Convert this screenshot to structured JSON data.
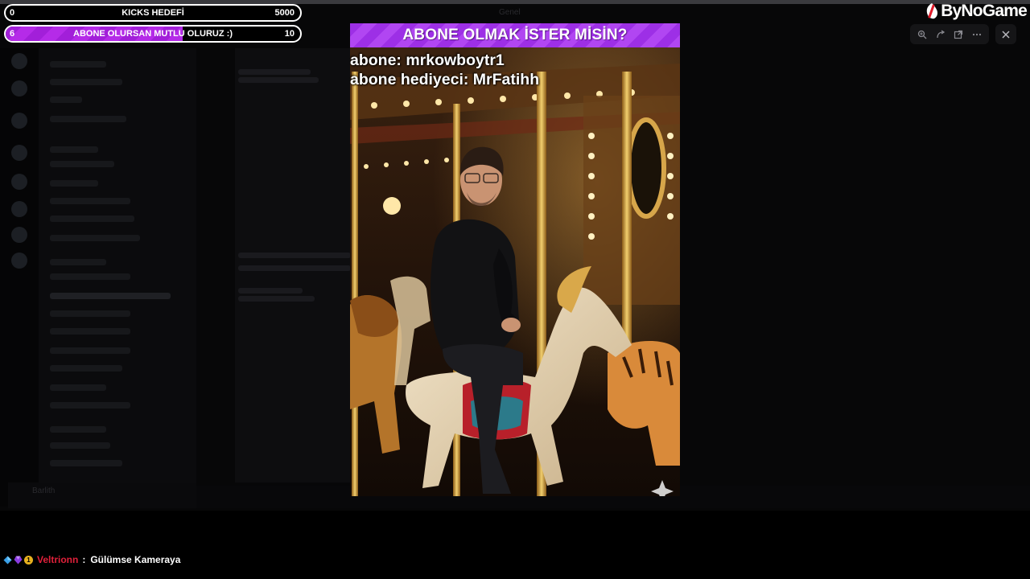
{
  "background": {
    "tab_label": "Genel",
    "user_name": "Barlith"
  },
  "goals": {
    "kicks": {
      "current": "0",
      "label": "KICKS HEDEFİ",
      "target": "5000",
      "progress": 0
    },
    "subs": {
      "current": "6",
      "label": "ABONE OLURSAN MUTLU OLURUZ :)",
      "target": "10",
      "progress": 0.6
    }
  },
  "brand": {
    "name": "ByNoGame"
  },
  "viewer_toolbar": {
    "icons": [
      "zoom-in-icon",
      "rotate-icon",
      "open-external-icon",
      "more-icon",
      "close-icon"
    ]
  },
  "popup": {
    "title": "ABONE OLMAK İSTER MİSİN?",
    "subscriber_line": "abone: mrkowboytr1",
    "gifter_line": "abone hediyeci: MrFatihh",
    "photo": "man in black hoodie riding a carousel horse among lion and tiger figures"
  },
  "chat": {
    "username": "Veltrionn",
    "separator": ":",
    "message": "Gülümse Kameraya",
    "badges": [
      "diamond-badge-icon",
      "purple-gem-badge-icon",
      "gold-number-badge-icon"
    ],
    "badge_number": "1",
    "username_color": "#e0203a"
  },
  "colors": {
    "accent_purple": "#a21fd9",
    "header_purple": "#9d2fe6"
  }
}
